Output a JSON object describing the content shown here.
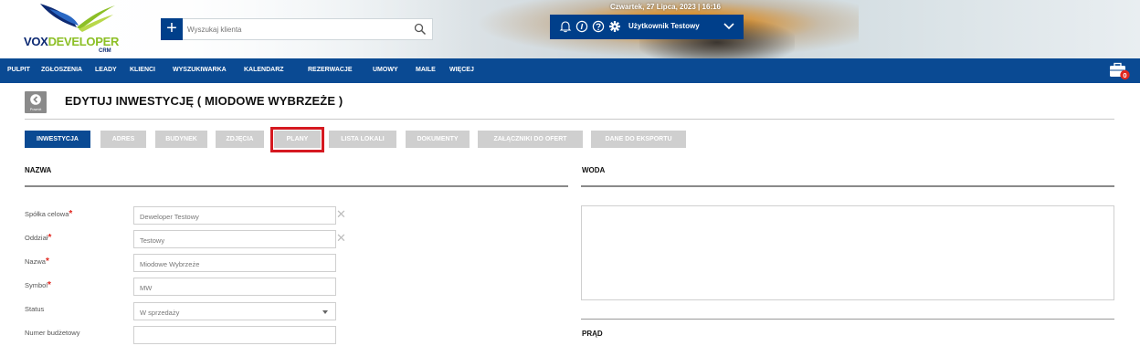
{
  "header": {
    "brand_vox": "VOX",
    "brand_dev": "DEVELOPER",
    "brand_crm": "CRM",
    "search_placeholder": "Wyszukaj klienta",
    "add_symbol": "+",
    "date_text": "Czwartek, 27 Lipca, 2023 | 16:16",
    "user_name": "Użytkownik Testowy",
    "icons": [
      "bell-icon",
      "info-icon",
      "help-icon",
      "gear-icon",
      "chevron-down-icon",
      "search-icon"
    ]
  },
  "nav": {
    "items": [
      "PULPIT",
      "ZGŁOSZENIA",
      "LEADY",
      "KLIENCI",
      "WYSZUKIWARKA",
      "KALENDARZ",
      "REZERWACJE",
      "UMOWY",
      "MAILE",
      "WIĘCEJ"
    ],
    "badge_count": "0"
  },
  "page": {
    "back_label": "Powrót",
    "title": "EDYTUJ INWESTYCJĘ ( MIODOWE WYBRZEŻE )"
  },
  "tabs": [
    {
      "label": "INWESTYCJA",
      "active": true
    },
    {
      "label": "ADRES",
      "active": false
    },
    {
      "label": "BUDYNEK",
      "active": false
    },
    {
      "label": "ZDJĘCIA",
      "active": false
    },
    {
      "label": "PLANY",
      "active": false,
      "highlighted": true
    },
    {
      "label": "LISTA LOKALI",
      "active": false
    },
    {
      "label": "DOKUMENTY",
      "active": false
    },
    {
      "label": "ZAŁĄCZNIKI DO OFERT",
      "active": false
    },
    {
      "label": "DANE DO EKSPORTU",
      "active": false
    }
  ],
  "sections": {
    "left_title": "NAZWA",
    "right_title_1": "WODA",
    "right_title_2": "PRĄD"
  },
  "form": {
    "required_mark": "*",
    "fields": [
      {
        "label": "Spółka celowa",
        "value": "Deweloper Testowy",
        "required": true,
        "clearable": true
      },
      {
        "label": "Oddział",
        "value": "Testowy",
        "required": true,
        "clearable": true
      },
      {
        "label": "Nazwa",
        "value": "Miodowe Wybrzeże",
        "required": true
      },
      {
        "label": "Symbol",
        "value": "MW",
        "required": true
      },
      {
        "label": "Status",
        "value": "W sprzedaży",
        "required": false,
        "select": true
      },
      {
        "label": "Numer budżetowy",
        "value": "",
        "required": false
      }
    ],
    "clear_symbol": "✕"
  },
  "colors": {
    "primary": "#0a4a93",
    "tab_inactive": "#cfcfcf",
    "highlight": "#d51920",
    "required": "#e1271f"
  }
}
